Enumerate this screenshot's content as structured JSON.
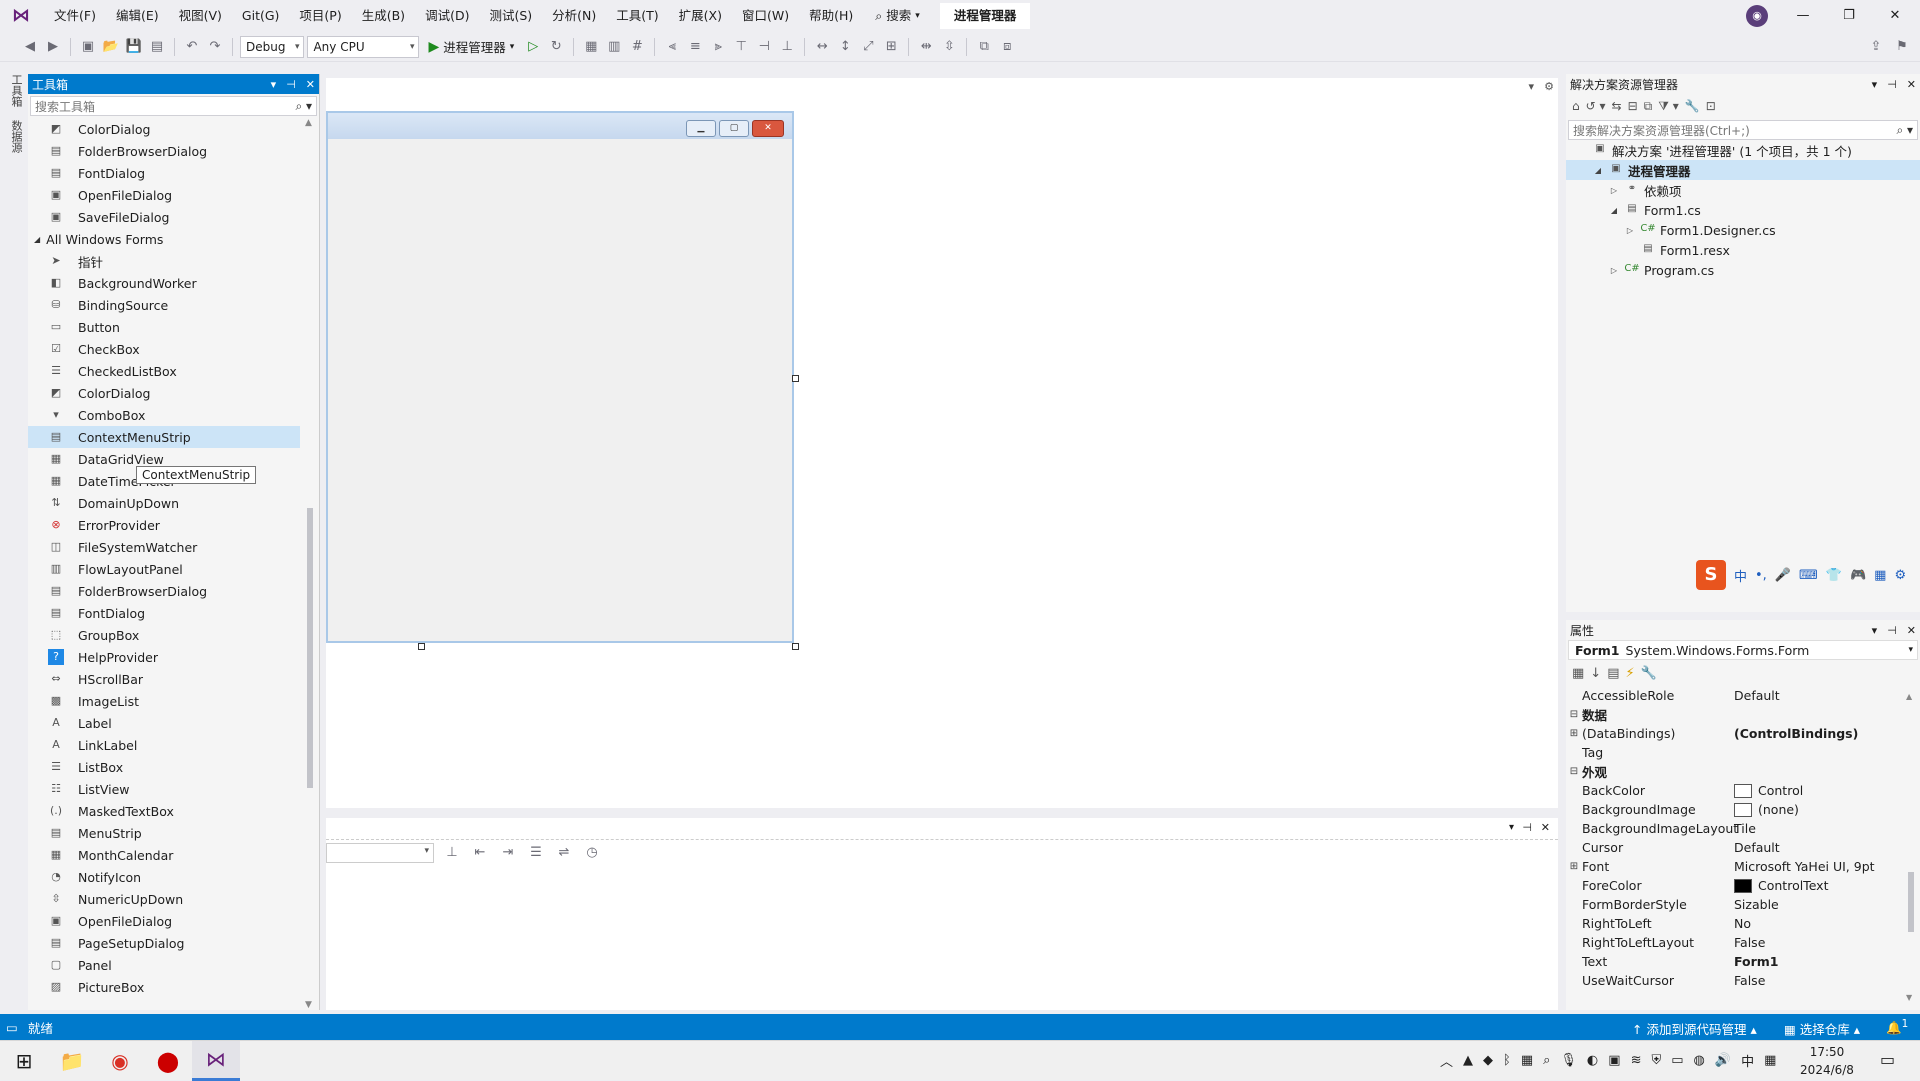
{
  "titlebar": {
    "menus": [
      "文件(F)",
      "编辑(E)",
      "视图(V)",
      "Git(G)",
      "项目(P)",
      "生成(B)",
      "调试(D)",
      "测试(S)",
      "分析(N)",
      "工具(T)",
      "扩展(X)",
      "窗口(W)",
      "帮助(H)"
    ],
    "search_label": "搜索",
    "project_title": "进程管理器",
    "window_controls": {
      "min": "—",
      "max": "❐",
      "close": "✕"
    }
  },
  "toolbar": {
    "config": "Debug",
    "platform": "Any CPU",
    "run_label": "进程管理器"
  },
  "left_strip": {
    "tabs": [
      "工具箱",
      "数据源"
    ]
  },
  "toolbox": {
    "title": "工具箱",
    "search_placeholder": "搜索工具箱",
    "category": "All Windows Forms",
    "items_before": [
      {
        "label": "ColorDialog",
        "icon": "color-dialog-icon"
      },
      {
        "label": "FolderBrowserDialog",
        "icon": "folder-browser-icon"
      },
      {
        "label": "FontDialog",
        "icon": "font-dialog-icon"
      },
      {
        "label": "OpenFileDialog",
        "icon": "open-file-icon"
      },
      {
        "label": "SaveFileDialog",
        "icon": "save-file-icon"
      }
    ],
    "items": [
      {
        "label": "指针",
        "icon": "pointer-icon"
      },
      {
        "label": "BackgroundWorker",
        "icon": "background-worker-icon"
      },
      {
        "label": "BindingSource",
        "icon": "binding-source-icon"
      },
      {
        "label": "Button",
        "icon": "button-icon"
      },
      {
        "label": "CheckBox",
        "icon": "checkbox-icon"
      },
      {
        "label": "CheckedListBox",
        "icon": "checked-listbox-icon"
      },
      {
        "label": "ColorDialog",
        "icon": "color-dialog-icon"
      },
      {
        "label": "ComboBox",
        "icon": "combobox-icon"
      },
      {
        "label": "ContextMenuStrip",
        "icon": "context-menu-icon"
      },
      {
        "label": "DataGridView",
        "icon": "datagrid-icon"
      },
      {
        "label": "DateTimePicker",
        "icon": "datetime-icon"
      },
      {
        "label": "DomainUpDown",
        "icon": "domain-updown-icon"
      },
      {
        "label": "ErrorProvider",
        "icon": "error-provider-icon"
      },
      {
        "label": "FileSystemWatcher",
        "icon": "file-watcher-icon"
      },
      {
        "label": "FlowLayoutPanel",
        "icon": "flow-layout-icon"
      },
      {
        "label": "FolderBrowserDialog",
        "icon": "folder-browser-icon"
      },
      {
        "label": "FontDialog",
        "icon": "font-dialog-icon"
      },
      {
        "label": "GroupBox",
        "icon": "groupbox-icon"
      },
      {
        "label": "HelpProvider",
        "icon": "help-provider-icon"
      },
      {
        "label": "HScrollBar",
        "icon": "hscrollbar-icon"
      },
      {
        "label": "ImageList",
        "icon": "imagelist-icon"
      },
      {
        "label": "Label",
        "icon": "label-icon"
      },
      {
        "label": "LinkLabel",
        "icon": "linklabel-icon"
      },
      {
        "label": "ListBox",
        "icon": "listbox-icon"
      },
      {
        "label": "ListView",
        "icon": "listview-icon"
      },
      {
        "label": "MaskedTextBox",
        "icon": "masked-textbox-icon"
      },
      {
        "label": "MenuStrip",
        "icon": "menustrip-icon"
      },
      {
        "label": "MonthCalendar",
        "icon": "calendar-icon"
      },
      {
        "label": "NotifyIcon",
        "icon": "notify-icon"
      },
      {
        "label": "NumericUpDown",
        "icon": "numeric-updown-icon"
      },
      {
        "label": "OpenFileDialog",
        "icon": "open-file-icon"
      },
      {
        "label": "PageSetupDialog",
        "icon": "page-setup-icon"
      },
      {
        "label": "Panel",
        "icon": "panel-icon"
      },
      {
        "label": "PictureBox",
        "icon": "picturebox-icon"
      }
    ],
    "tooltip": "ContextMenuStrip"
  },
  "solution": {
    "title": "解决方案资源管理器",
    "search_placeholder": "搜索解决方案资源管理器(Ctrl+;)",
    "tree": [
      {
        "label": "解决方案 '进程管理器' (1 个项目，共 1 个)",
        "indent": 0,
        "tri": "",
        "icon": "solution-icon"
      },
      {
        "label": "进程管理器",
        "indent": 1,
        "tri": "◢",
        "icon": "project-icon",
        "sel": true,
        "bold": true
      },
      {
        "label": "依赖项",
        "indent": 2,
        "tri": "▷",
        "icon": "dependencies-icon"
      },
      {
        "label": "Form1.cs",
        "indent": 2,
        "tri": "◢",
        "icon": "form-icon"
      },
      {
        "label": "Form1.Designer.cs",
        "indent": 3,
        "tri": "▷",
        "icon": "csharp-icon"
      },
      {
        "label": "Form1.resx",
        "indent": 3,
        "tri": "",
        "icon": "resx-icon"
      },
      {
        "label": "Program.cs",
        "indent": 2,
        "tri": "▷",
        "icon": "csharp-icon"
      }
    ]
  },
  "ime": {
    "items": [
      "中",
      "•,",
      "🎤",
      "⌨",
      "👕",
      "🎮",
      "▦",
      "⚙"
    ]
  },
  "properties": {
    "title": "属性",
    "object_name": "Form1",
    "object_type": "System.Windows.Forms.Form",
    "rows": [
      {
        "name": "AccessibleRole",
        "value": "Default"
      },
      {
        "name": "数据",
        "cat": true,
        "exp": "⊟"
      },
      {
        "name": "(DataBindings)",
        "value": "(ControlBindings)",
        "exp": "⊞",
        "bold": true
      },
      {
        "name": "Tag",
        "value": ""
      },
      {
        "name": "外观",
        "cat": true,
        "exp": "⊟"
      },
      {
        "name": "BackColor",
        "value": "Control",
        "swatch": "#ffffff"
      },
      {
        "name": "BackgroundImage",
        "value": "(none)",
        "swatch": "#ffffff"
      },
      {
        "name": "BackgroundImageLayout",
        "value": "Tile"
      },
      {
        "name": "Cursor",
        "value": "Default"
      },
      {
        "name": "Font",
        "value": "Microsoft YaHei UI, 9pt",
        "exp": "⊞"
      },
      {
        "name": "ForeColor",
        "value": "ControlText",
        "swatch": "#000000"
      },
      {
        "name": "FormBorderStyle",
        "value": "Sizable"
      },
      {
        "name": "RightToLeft",
        "value": "No"
      },
      {
        "name": "RightToLeftLayout",
        "value": "False"
      },
      {
        "name": "Text",
        "value": "Form1",
        "bold": true
      },
      {
        "name": "UseWaitCursor",
        "value": "False"
      }
    ]
  },
  "statusbar": {
    "ready": "就绪",
    "source_control": "添加到源代码管理",
    "repo": "选择仓库",
    "notif_count": "1"
  },
  "taskbar": {
    "time": "17:50",
    "date": "2024/6/8",
    "ime_lang": "中"
  },
  "colors": {
    "accent": "#007acc",
    "selection": "#cce4f7"
  }
}
